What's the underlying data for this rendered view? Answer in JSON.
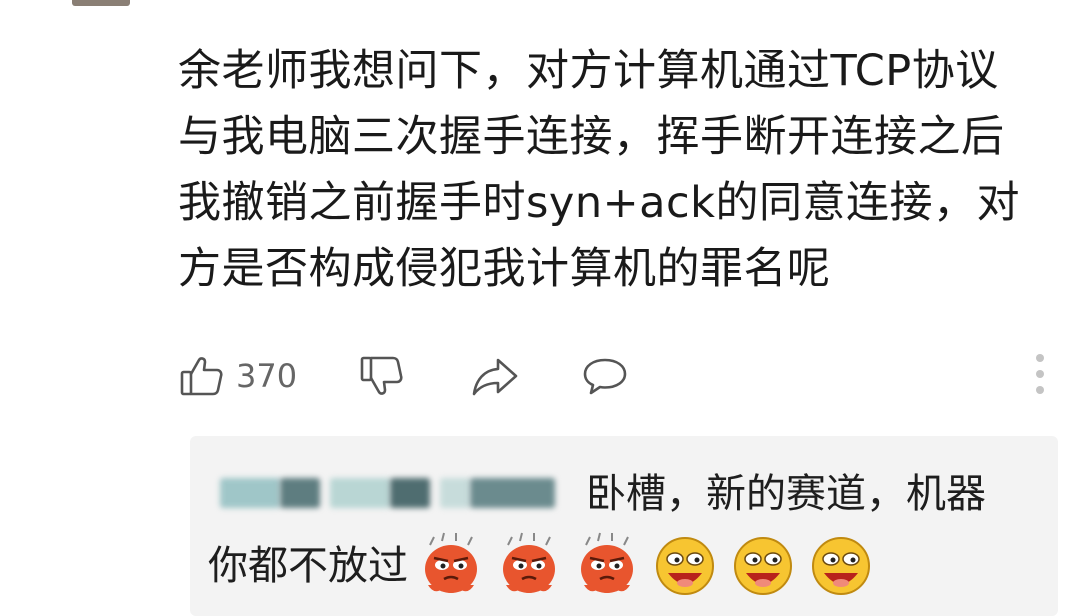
{
  "comment": {
    "lines": [
      "余老师我想问下，对方计算机通过TCP协议",
      "与我电脑三次握手连接，挥手断开连接之后",
      "我撤销之前握手时syn+ack的同意连接，对",
      "方是否构成侵犯我计算机的罪名呢"
    ]
  },
  "actions": {
    "like_count": "370",
    "icons": [
      "thumbs-up-icon",
      "thumbs-down-icon",
      "share-icon",
      "comment-icon",
      "more-vertical-icon"
    ]
  },
  "reply": {
    "line1": "卧槽，新的赛道，机器",
    "line2": "你都不放过",
    "emojis": [
      "angry-red-emoji",
      "angry-red-emoji",
      "angry-red-emoji",
      "laughing-yellow-emoji",
      "laughing-yellow-emoji",
      "laughing-yellow-emoji"
    ]
  },
  "colors": {
    "text": "#1a1a1a",
    "muted": "#666666",
    "reply_bg": "#f3f3f3"
  }
}
